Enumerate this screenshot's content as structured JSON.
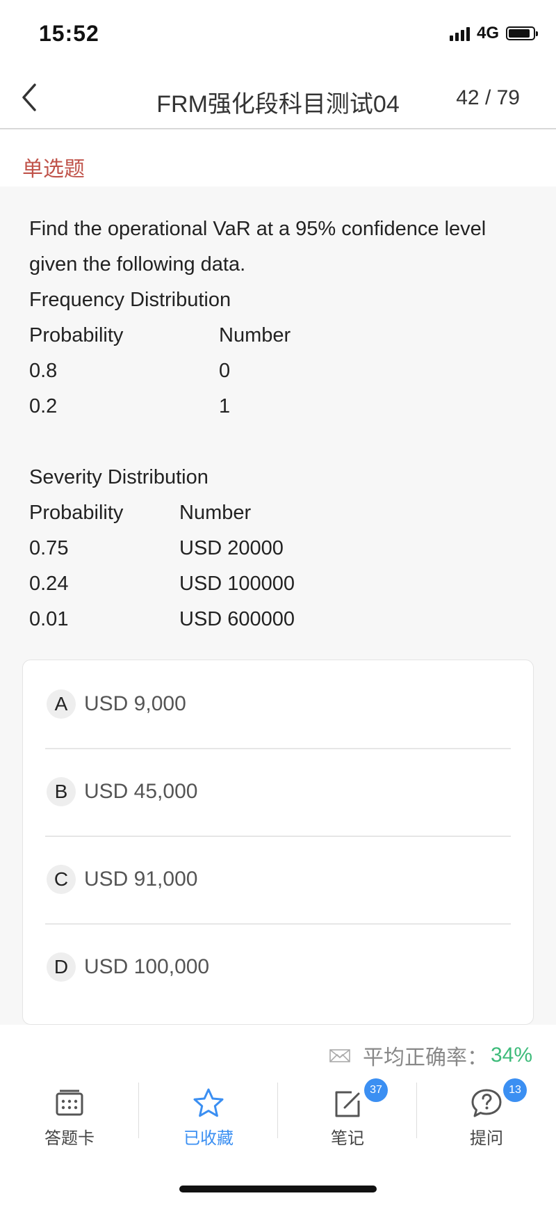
{
  "status_bar": {
    "time": "15:52",
    "network": "4G"
  },
  "nav": {
    "back_icon": "chevron-left-icon",
    "title": "FRM强化段科目测试04",
    "counter": "42 / 79"
  },
  "question_type": "单选题",
  "question": {
    "text_lines": [
      "Find the operational VaR at a 95% confidence level",
      "given the following data.",
      "Frequency Distribution"
    ],
    "frequency": {
      "headers": [
        "Probability",
        "Number"
      ],
      "rows": [
        [
          "0.8",
          "0"
        ],
        [
          "0.2",
          "1"
        ]
      ]
    },
    "severity_title": "Severity Distribution",
    "severity": {
      "headers": [
        "Probability",
        "Number"
      ],
      "rows": [
        [
          "0.75",
          "USD 20000"
        ],
        [
          "0.24",
          "USD 100000"
        ],
        [
          "0.01",
          "USD 600000"
        ]
      ]
    }
  },
  "options": [
    {
      "letter": "A",
      "text": "USD 9,000"
    },
    {
      "letter": "B",
      "text": "USD 45,000"
    },
    {
      "letter": "C",
      "text": "USD 91,000"
    },
    {
      "letter": "D",
      "text": "USD 100,000"
    }
  ],
  "accuracy": {
    "label": "平均正确率：",
    "value": "34%"
  },
  "toolbar": [
    {
      "label": "答题卡",
      "icon": "answer-sheet-icon"
    },
    {
      "label": "已收藏",
      "icon": "star-icon",
      "active": true
    },
    {
      "label": "笔记",
      "icon": "note-edit-icon",
      "badge": "37"
    },
    {
      "label": "提问",
      "icon": "question-bubble-icon",
      "badge": "13"
    }
  ],
  "colors": {
    "accent": "#3b8ff2",
    "question_type": "#c0534a",
    "accuracy": "#3dbb7a"
  }
}
